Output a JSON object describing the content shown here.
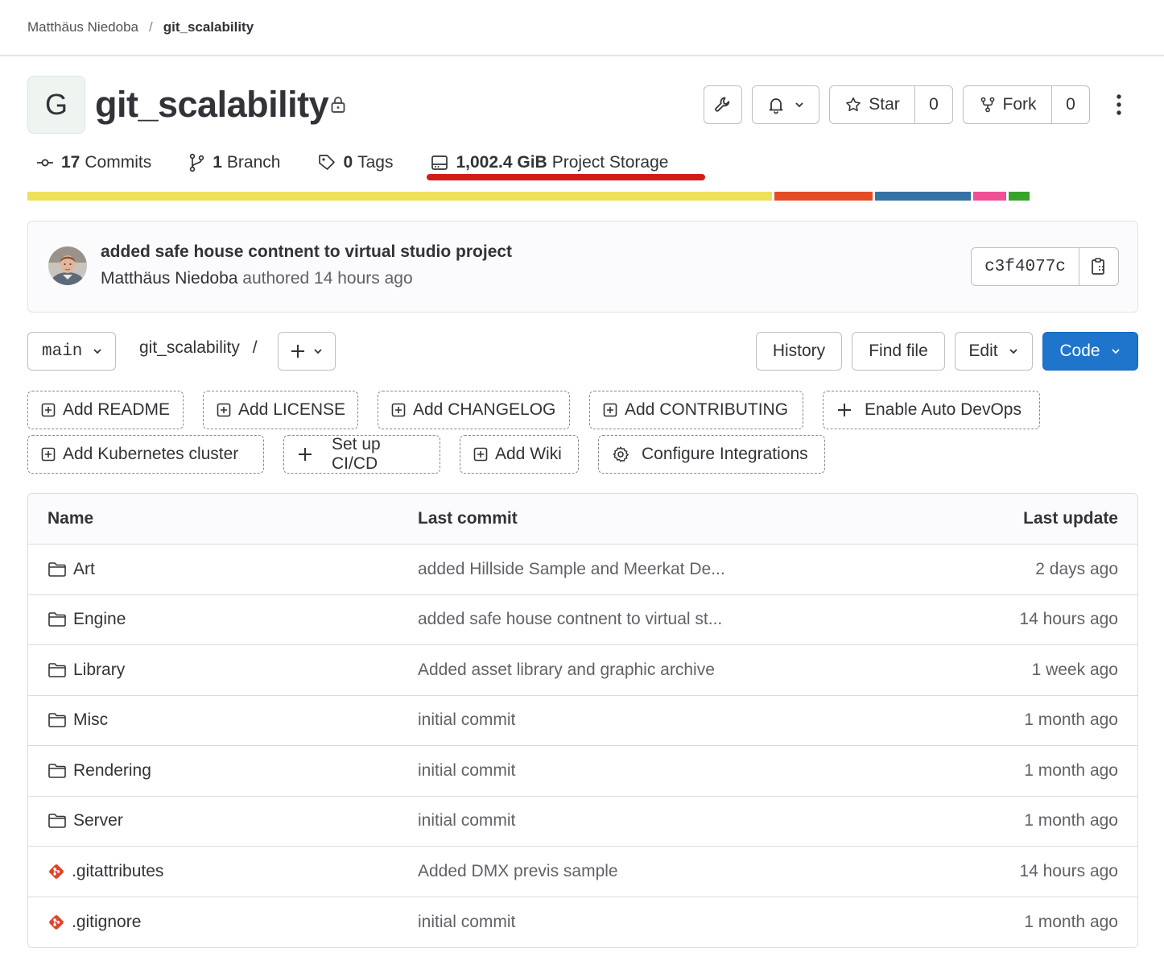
{
  "breadcrumb": {
    "owner": "Matthäus Niedoba",
    "separator": "/",
    "project": "git_scalability"
  },
  "project": {
    "avatar_letter": "G",
    "name": "git_scalability"
  },
  "actions": {
    "star_label": "Star",
    "star_count": "0",
    "fork_label": "Fork",
    "fork_count": "0"
  },
  "stats": {
    "commits_count": "17",
    "commits_label": "Commits",
    "branch_count": "1",
    "branch_label": "Branch",
    "tags_count": "0",
    "tags_label": "Tags",
    "storage_value": "1,002.4 GiB",
    "storage_label": "Project Storage"
  },
  "language_bar": [
    {
      "color": "#ede05a",
      "share": 0.707
    },
    {
      "color": "#e34c26",
      "share": 0.093
    },
    {
      "color": "#3572a5",
      "share": 0.091
    },
    {
      "color": "#f05096",
      "share": 0.031
    },
    {
      "color": "#38a329",
      "share": 0.02
    }
  ],
  "last_commit": {
    "message": "added safe house contnent to virtual studio project",
    "author": "Matthäus Niedoba",
    "authored_text": "authored 14 hours ago",
    "sha": "c3f4077c"
  },
  "toolbar": {
    "branch": "main",
    "path": "git_scalability",
    "path_sep": "/",
    "history": "History",
    "find_file": "Find file",
    "edit": "Edit",
    "code": "Code"
  },
  "suggestions": [
    "Add README",
    "Add LICENSE",
    "Add CHANGELOG",
    "Add CONTRIBUTING",
    "Enable Auto DevOps",
    "Add Kubernetes cluster",
    "Set up CI/CD",
    "Add Wiki",
    "Configure Integrations"
  ],
  "table": {
    "headers": {
      "name": "Name",
      "commit": "Last commit",
      "update": "Last update"
    },
    "rows": [
      {
        "name": "Art",
        "type": "folder-icon",
        "commit": "added Hillside Sample and Meerkat De...",
        "date": "2 days ago"
      },
      {
        "name": "Engine",
        "type": "folder-icon",
        "commit": "added safe house contnent to virtual st...",
        "date": "14 hours ago"
      },
      {
        "name": "Library",
        "type": "folder-icon",
        "commit": "Added asset library and graphic archive",
        "date": "1 week ago"
      },
      {
        "name": "Misc",
        "type": "folder-icon",
        "commit": "initial commit",
        "date": "1 month ago"
      },
      {
        "name": "Rendering",
        "type": "folder-icon",
        "commit": "initial commit",
        "date": "1 month ago"
      },
      {
        "name": "Server",
        "type": "folder-icon",
        "commit": "initial commit",
        "date": "1 month ago"
      },
      {
        "name": ".gitattributes",
        "type": "git-file-icon",
        "commit": "Added DMX previs sample",
        "date": "14 hours ago"
      },
      {
        "name": ".gitignore",
        "type": "git-file-icon",
        "commit": "initial commit",
        "date": "1 month ago"
      }
    ]
  }
}
